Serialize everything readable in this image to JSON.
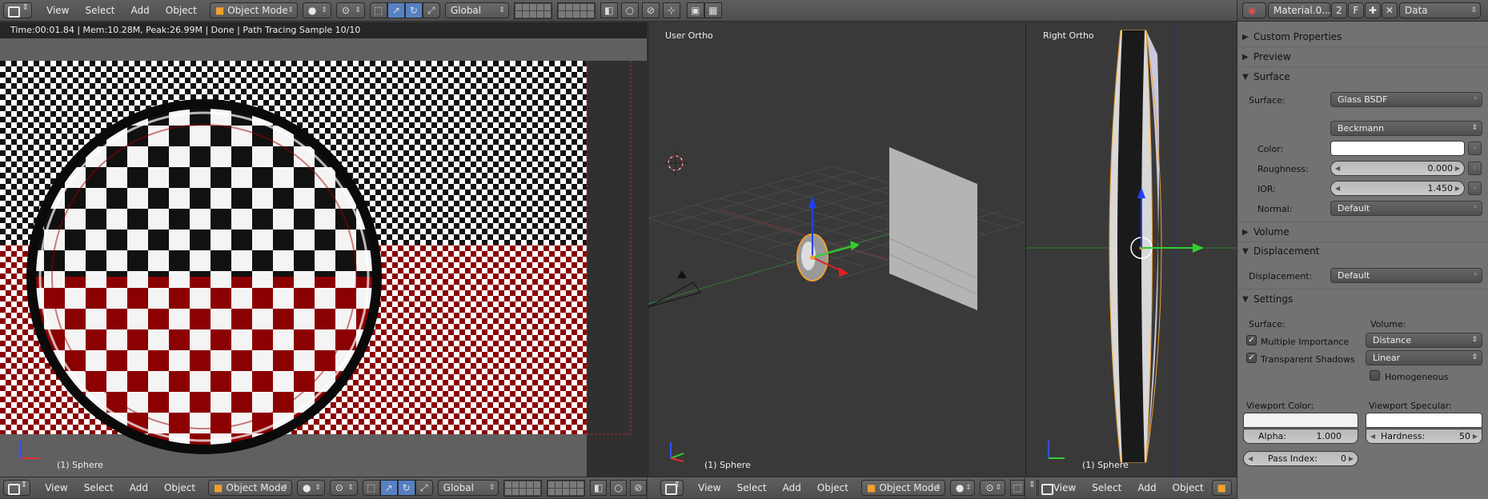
{
  "top_header": {
    "menus": [
      "View",
      "Select",
      "Add",
      "Object"
    ],
    "mode": "Object Mode",
    "orientation": "Global"
  },
  "render_view": {
    "status": "Time:00:01.84 | Mem:10.28M, Peak:26.99M | Done | Path Tracing Sample 10/10",
    "object_label": "(1) Sphere"
  },
  "user_view": {
    "label": "User Ortho",
    "object_label": "(1) Sphere"
  },
  "right_view": {
    "label": "Right Ortho",
    "object_label": "(1) Sphere"
  },
  "bottom_header_left": {
    "menus": [
      "View",
      "Select",
      "Add",
      "Object"
    ],
    "mode": "Object Mode",
    "orientation": "Global"
  },
  "bottom_header_mid": {
    "menus": [
      "View",
      "Select",
      "Add",
      "Object"
    ],
    "mode": "Object Mode"
  },
  "bottom_header_right": {
    "menus": [
      "View",
      "Select",
      "Add",
      "Object"
    ]
  },
  "properties": {
    "material_name": "Material.0...",
    "users": "2",
    "fake_user": "F",
    "context": "Data",
    "panels": {
      "custom_properties": "Custom Properties",
      "preview": "Preview",
      "surface": "Surface",
      "volume": "Volume",
      "displacement": "Displacement",
      "settings": "Settings"
    },
    "surface": {
      "surface_label": "Surface:",
      "surface_value": "Glass BSDF",
      "distribution": "Beckmann",
      "color_label": "Color:",
      "color_value": "#ffffff",
      "roughness_label": "Roughness:",
      "roughness_value": "0.000",
      "ior_label": "IOR:",
      "ior_value": "1.450",
      "normal_label": "Normal:",
      "normal_value": "Default"
    },
    "displacement": {
      "label": "Displacement:",
      "value": "Default"
    },
    "settings": {
      "surface_heading": "Surface:",
      "volume_heading": "Volume:",
      "multiple_importance": "Multiple Importance",
      "multiple_importance_checked": true,
      "transparent_shadows": "Transparent Shadows",
      "transparent_shadows_checked": true,
      "volume_sampling": "Distance",
      "volume_interpolation": "Linear",
      "homogeneous": "Homogeneous",
      "homogeneous_checked": false,
      "viewport_color_label": "Viewport Color:",
      "viewport_specular_label": "Viewport Specular:",
      "alpha_label": "Alpha:",
      "alpha_value": "1.000",
      "hardness_label": "Hardness:",
      "hardness_value": "50",
      "pass_index_label": "Pass Index:",
      "pass_index_value": "0"
    }
  },
  "colors": {
    "selection": "#f0a030",
    "axis_x": "#e02020",
    "axis_y": "#30d030",
    "axis_z": "#2040ff",
    "checker_red": "#8b0000"
  }
}
